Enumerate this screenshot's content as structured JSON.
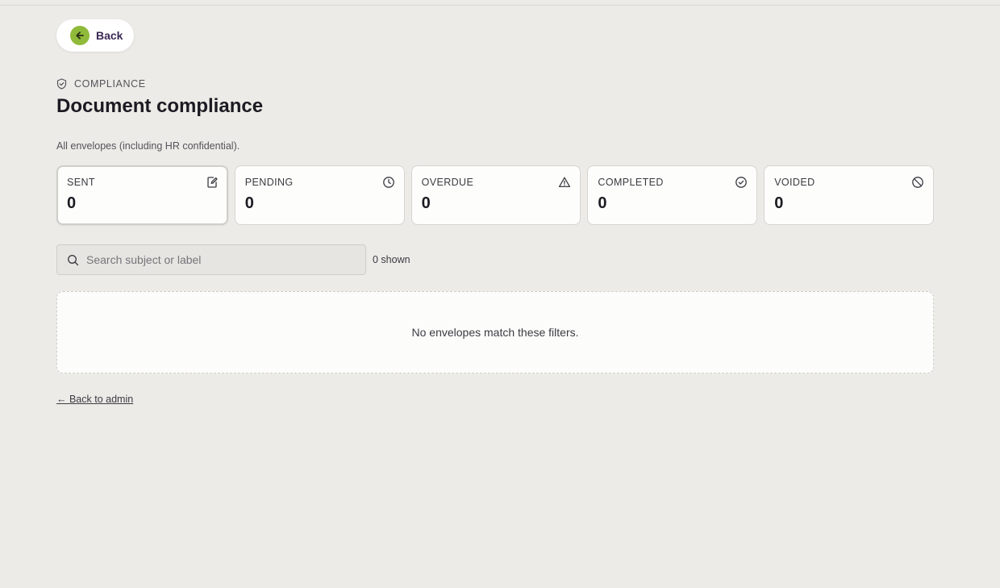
{
  "back_button": {
    "label": "Back",
    "icon": "arrow-left-icon",
    "icon_bg": "#8fba3a"
  },
  "header": {
    "eyebrow": "COMPLIANCE",
    "eyebrow_icon": "shield-check-icon",
    "title": "Document compliance",
    "subtitle": "All envelopes (including HR confidential)."
  },
  "stats": [
    {
      "label": "SENT",
      "value": "0",
      "icon": "edit-document-icon"
    },
    {
      "label": "PENDING",
      "value": "0",
      "icon": "clock-icon"
    },
    {
      "label": "OVERDUE",
      "value": "0",
      "icon": "warning-triangle-icon"
    },
    {
      "label": "COMPLETED",
      "value": "0",
      "icon": "check-circle-icon"
    },
    {
      "label": "VOIDED",
      "value": "0",
      "icon": "ban-icon"
    }
  ],
  "search": {
    "placeholder": "Search subject or label",
    "value": "",
    "icon": "search-icon"
  },
  "results_count": "0 shown",
  "empty_state": "No envelopes match these filters.",
  "footer_link": "← Back to admin"
}
